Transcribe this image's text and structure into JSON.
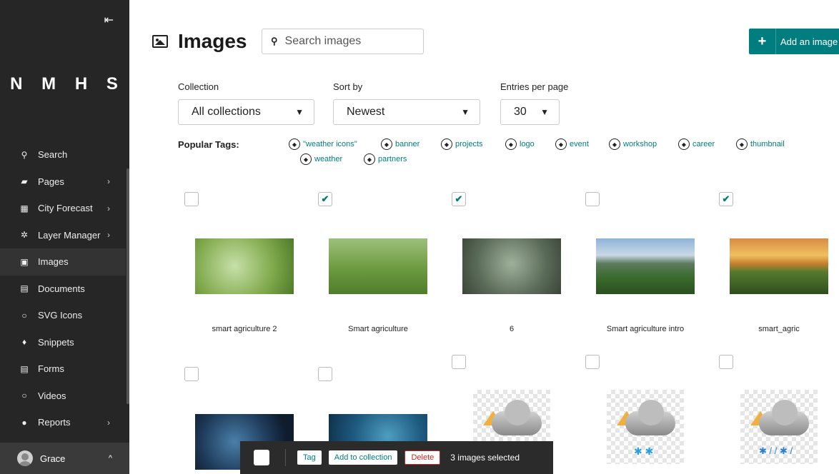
{
  "sidebar": {
    "brand": "N M H S",
    "collapse_icon": "collapse-left-icon",
    "items": [
      {
        "label": "Search",
        "icon": "search-icon",
        "glyph": "🔍︎"
      },
      {
        "label": "Pages",
        "icon": "folder-icon",
        "glyph": "▰"
      },
      {
        "label": "City Forecast",
        "icon": "table-icon",
        "glyph": "▦"
      },
      {
        "label": "Layer Manager",
        "icon": "cog-icon",
        "glyph": "✲"
      },
      {
        "label": "Images",
        "icon": "image-icon",
        "glyph": "▣"
      },
      {
        "label": "Documents",
        "icon": "document-icon",
        "glyph": "▤"
      },
      {
        "label": "SVG Icons",
        "icon": "circle-icon",
        "glyph": "○"
      },
      {
        "label": "Snippets",
        "icon": "snippet-icon",
        "glyph": "♦"
      },
      {
        "label": "Forms",
        "icon": "form-icon",
        "glyph": "▤"
      },
      {
        "label": "Videos",
        "icon": "circle-icon",
        "glyph": "○"
      },
      {
        "label": "Reports",
        "icon": "globe-icon",
        "glyph": "●"
      }
    ],
    "user": "Grace"
  },
  "header": {
    "title": "Images",
    "search_placeholder": "Search images",
    "add_button": "Add an image"
  },
  "filters": {
    "collection_label": "Collection",
    "collection_value": "All collections",
    "sort_label": "Sort by",
    "sort_value": "Newest",
    "entries_label": "Entries per page",
    "entries_value": "30"
  },
  "tags": {
    "label": "Popular Tags:",
    "items": [
      "\"weather icons\"",
      "banner",
      "projects",
      "logo",
      "event",
      "workshop",
      "career",
      "thumbnail",
      "weather",
      "partners"
    ]
  },
  "images": [
    {
      "title": "smart agriculture 2",
      "checked": false
    },
    {
      "title": "Smart agriculture",
      "checked": true
    },
    {
      "title": "6",
      "checked": true
    },
    {
      "title": "Smart agriculture intro",
      "checked": false
    },
    {
      "title": "smart_agric",
      "checked": true
    },
    {
      "title": "",
      "checked": false
    },
    {
      "title": "",
      "checked": false
    },
    {
      "title": "",
      "checked": false
    },
    {
      "title": "",
      "checked": false
    },
    {
      "title": "",
      "checked": false
    }
  ],
  "bulk": {
    "tag_button": "Tag",
    "collection_button": "Add to collection",
    "delete_button": "Delete",
    "count_text": "3 images selected"
  }
}
